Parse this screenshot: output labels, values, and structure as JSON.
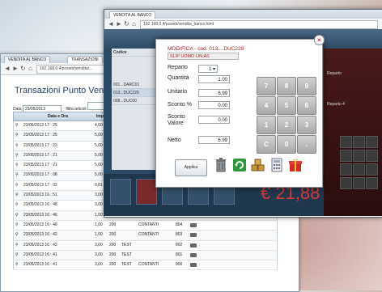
{
  "back_window": {
    "tabs": [
      "VENDITA AL BANCO",
      "TRANSAZIONI"
    ],
    "url": "192.168.0.4/pcweb/vendita/...",
    "title": "Transazioni Punto Vendita 001",
    "date_label": "Data",
    "date_value": "23/05/2013",
    "filter_label": "filtra articoli",
    "columns": [
      "Data e Ora",
      "Importo Tot."
    ],
    "rows": [
      {
        "dt": "23/05/2013 17 : 25",
        "amt": "4,50",
        "c3": "",
        "c4": "",
        "c5": "",
        "c6": ""
      },
      {
        "dt": "23/05/2013 17 : 25",
        "amt": "5,00",
        "c3": "",
        "c4": "",
        "c5": "",
        "c6": ""
      },
      {
        "dt": "23/05/2013 17 : 23",
        "amt": "5,00",
        "c3": "",
        "c4": "",
        "c5": "",
        "c6": ""
      },
      {
        "dt": "23/05/2013 17 : 21",
        "amt": "5,00",
        "c3": "",
        "c4": "",
        "c5": "",
        "c6": ""
      },
      {
        "dt": "23/05/2013 17 : 21",
        "amt": "5,00",
        "c3": "",
        "c4": "",
        "c5": "",
        "c6": ""
      },
      {
        "dt": "23/05/2013 17 : 08",
        "amt": "5,00",
        "c3": "",
        "c4": "",
        "c5": "",
        "c6": ""
      },
      {
        "dt": "23/05/2013 17 : 02",
        "amt": "0,61",
        "c3": "",
        "c4": "",
        "c5": "",
        "c6": ""
      },
      {
        "dt": "23/05/2013 16 : 51",
        "amt": "3,00",
        "c3": "",
        "c4": "",
        "c5": "",
        "c6": ""
      },
      {
        "dt": "23/05/2013 16 : 48",
        "amt": "3,00",
        "c3": "200",
        "c4": "TEST",
        "c5": "",
        "c6": "806"
      },
      {
        "dt": "23/05/2013 16 : 46",
        "amt": "1,00",
        "c3": "200",
        "c4": "",
        "c5": "CONTANTI",
        "c6": "806"
      },
      {
        "dt": "23/05/2013 16 : 46",
        "amt": "1,00",
        "c3": "200",
        "c4": "",
        "c5": "CONTANTI",
        "c6": "804"
      },
      {
        "dt": "23/05/2013 16 : 42",
        "amt": "1,00",
        "c3": "200",
        "c4": "",
        "c5": "CONTANTI",
        "c6": "803"
      },
      {
        "dt": "23/05/2013 16 : 42",
        "amt": "3,00",
        "c3": "200",
        "c4": "TEST",
        "c5": "",
        "c6": "802"
      },
      {
        "dt": "23/05/2013 16 : 41",
        "amt": "3,00",
        "c3": "200",
        "c4": "TEST",
        "c5": "",
        "c6": "801"
      },
      {
        "dt": "23/05/2013 16 : 41",
        "amt": "3,00",
        "c3": "200",
        "c4": "TEST",
        "c5": "CONTANTI",
        "c6": "800"
      }
    ]
  },
  "front_window": {
    "tab": "VENDITA AL BANCO",
    "url": "192.168.0.4/pcweb/vendita_banco.html",
    "left_header": "Codice",
    "left_rows": [
      "001...DARC01",
      "013...DUC229",
      "008...DUC00"
    ],
    "right_labels": [
      "Reparto",
      "Reparto 4"
    ],
    "total": "€ 21,88",
    "bottom_buttons": [
      "",
      "",
      "",
      "",
      "",
      ""
    ]
  },
  "modal": {
    "title": "MODIFICA - cod. 013....DUC229",
    "name": "SLIP UOMO UN.AS",
    "fields": [
      {
        "label": "Reparto",
        "value": "1"
      },
      {
        "label": "Quantità",
        "value": "1.00"
      },
      {
        "label": "Unitario",
        "value": "6.99"
      },
      {
        "label": "Sconto %",
        "value": "0.00"
      },
      {
        "label": "Sconto Valore",
        "value": "0.00"
      },
      {
        "label": "Netto",
        "value": "6.99"
      }
    ],
    "keypad": [
      "7",
      "8",
      "9",
      "4",
      "5",
      "6",
      "1",
      "2",
      "3",
      "C",
      "0",
      "."
    ],
    "apply_label": "Applica",
    "colors": {
      "title": "#b02020",
      "key": "#b5b5b5"
    }
  }
}
